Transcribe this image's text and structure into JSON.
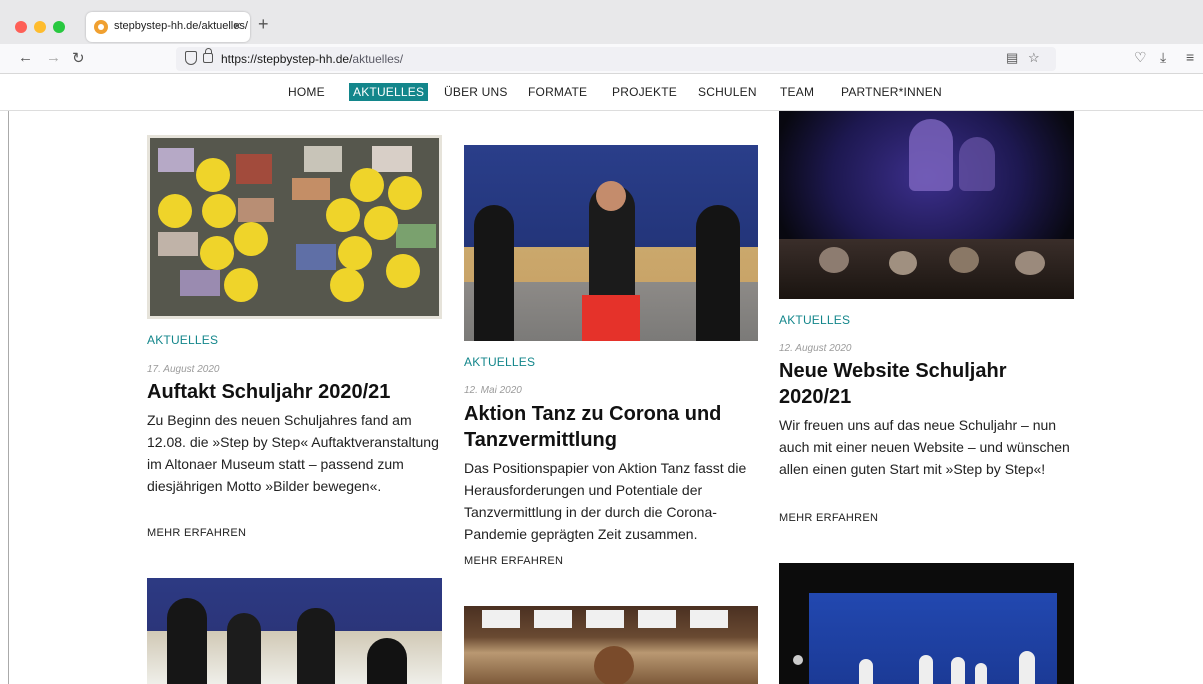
{
  "browser": {
    "tab_title": "stepbystep-hh.de/aktuelles/",
    "tab_close": "×",
    "new_tab": "+",
    "url_host": "https://stepbystep-hh.de/",
    "url_path": "aktuelles/"
  },
  "nav": {
    "items": [
      {
        "label": "HOME"
      },
      {
        "label": "AKTUELLES",
        "active": true
      },
      {
        "label": "ÜBER UNS"
      },
      {
        "label": "FORMATE"
      },
      {
        "label": "PROJEKTE"
      },
      {
        "label": "SCHULEN"
      },
      {
        "label": "TEAM"
      },
      {
        "label": "PARTNER*INNEN"
      }
    ]
  },
  "posts": [
    {
      "category": "AKTUELLES",
      "date": "17. August 2020",
      "title": "Auftakt Schuljahr 2020/21",
      "excerpt": "Zu Beginn des neuen Schuljahres fand am 12.08. die »Step by Step« Auftaktveranstaltung im Altonaer Museum statt – passend zum diesjährigen Motto »Bilder bewegen«.",
      "more": "MEHR ERFAHREN"
    },
    {
      "category": "AKTUELLES",
      "date": "12. Mai 2020",
      "title": "Aktion Tanz zu Corona und Tanzvermittlung",
      "excerpt": "Das Positionspapier von Aktion Tanz fasst die Herausforderungen und Potentiale der Tanzvermittlung in der durch die Corona-Pandemie geprägten Zeit zusammen.",
      "more": "MEHR ERFAHREN"
    },
    {
      "category": "AKTUELLES",
      "date": "12. August 2020",
      "title": "Neue Website Schuljahr 2020/21",
      "excerpt": "Wir freuen uns auf das neue Schuljahr – nun auch mit einer neuen Website – und wünschen allen einen guten Start mit »Step by Step«!",
      "more": "MEHR ERFAHREN"
    }
  ],
  "icons": {
    "back": "arrow-left-icon",
    "forward": "arrow-right-icon",
    "reload": "reload-icon",
    "reader": "reader-view-icon",
    "bookmark": "star-icon",
    "pocket": "pocket-icon",
    "downloads": "download-icon",
    "menu": "hamburger-menu-icon"
  }
}
